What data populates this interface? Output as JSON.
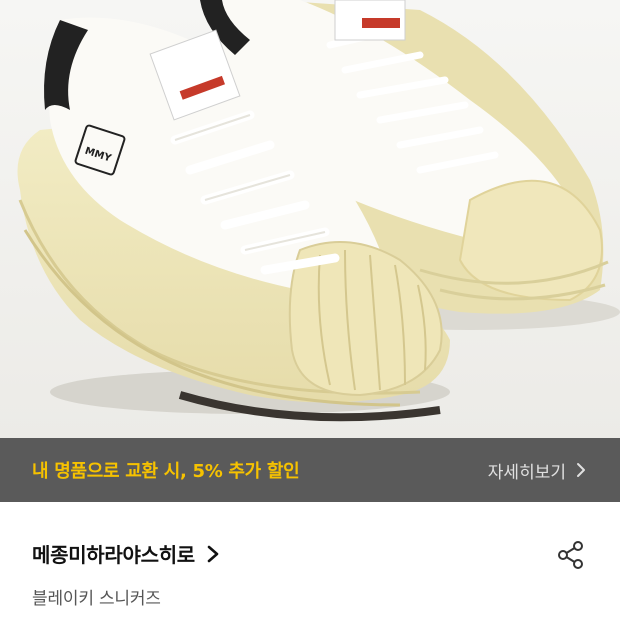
{
  "promo": {
    "text": "내 명품으로 교환 시, 5% 추가 할인",
    "link_label": "자세히보기",
    "link_icon": "chevron-right-icon",
    "text_color": "#f6c200",
    "bg_color": "#5a5a5a"
  },
  "product": {
    "image_icon": "sneaker-photo",
    "brand": "메종미하라야스히로",
    "brand_icon": "chevron-right-icon",
    "name": "블레이키 스니커즈",
    "share_icon": "share-icon"
  }
}
